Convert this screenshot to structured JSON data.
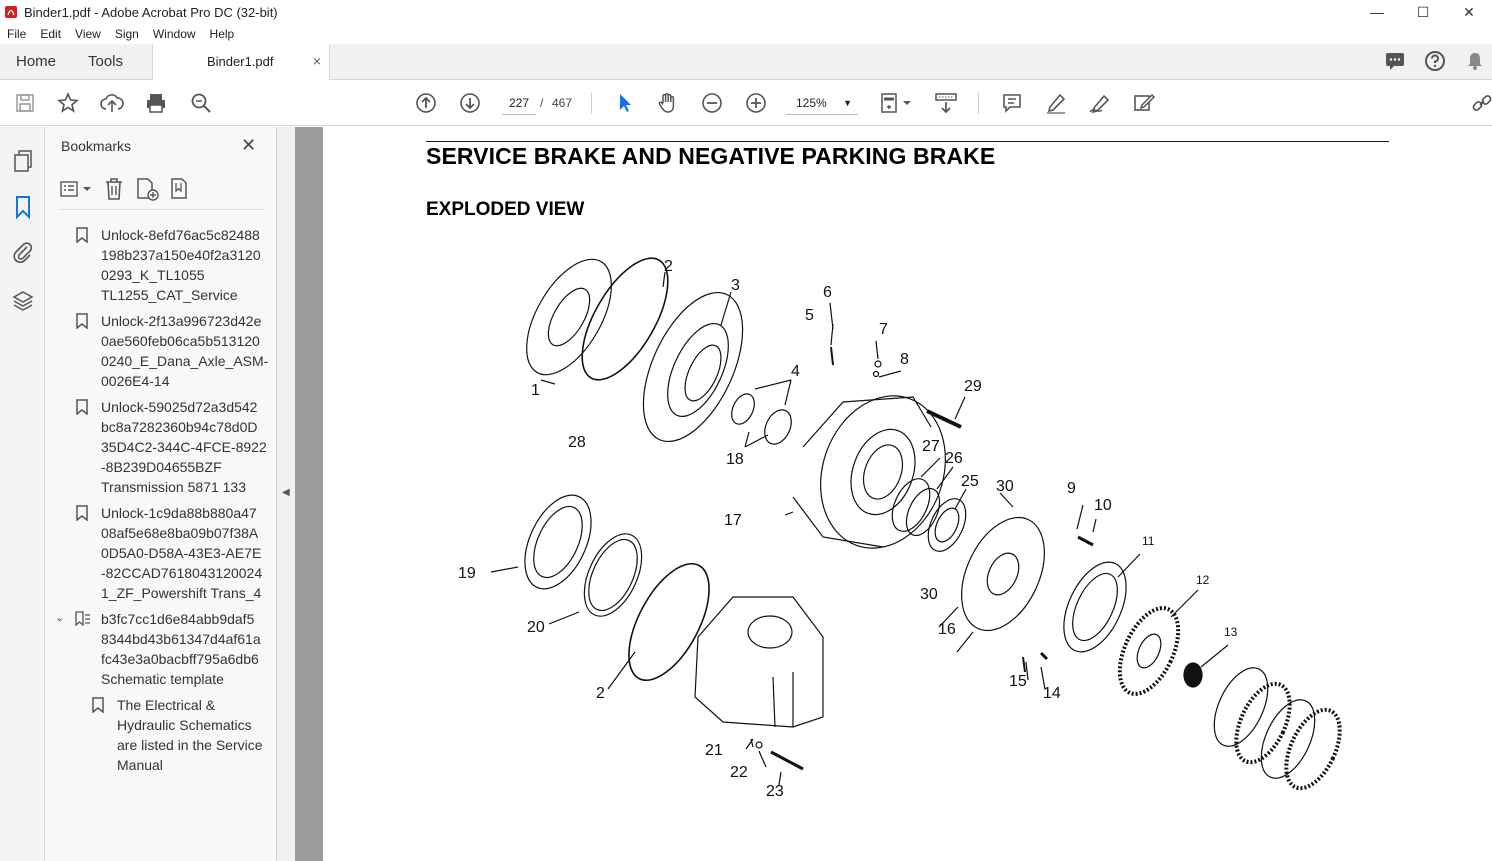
{
  "window": {
    "title": "Binder1.pdf - Adobe Acrobat Pro DC (32-bit)",
    "controls": [
      "—",
      "☐",
      "✕"
    ]
  },
  "menu": [
    "File",
    "Edit",
    "View",
    "Sign",
    "Window",
    "Help"
  ],
  "tabs": {
    "home": "Home",
    "tools": "Tools",
    "document": "Binder1.pdf",
    "close": "×"
  },
  "toolbar": {
    "current_page": "227",
    "separator": "/",
    "total_pages": "467",
    "zoom": "125%",
    "zoom_caret": "▼"
  },
  "bookmarks": {
    "title": "Bookmarks",
    "close": "✕",
    "items": [
      {
        "label": "Unlock-8efd76ac5c82488\n198b237a150e40f2a3120\n0293_K_TL1055\nTL1255_CAT_Service"
      },
      {
        "label": "Unlock-2f13a996723d42e\n0ae560feb06ca5b513120\n0240_E_Dana_Axle_ASM-\n0026E4-14"
      },
      {
        "label": "Unlock-59025d72a3d542\nbc8a7282360b94c78d0D\n35D4C2-344C-4FCE-8922\n-8B239D04655BZF\nTransmission 5871 133"
      },
      {
        "label": "Unlock-1c9da88b880a47\n08af5e68e8ba09b07f38A\n0D5A0-D58A-43E3-AE7E\n-82CCAD7618043120024\n1_ZF_Powershift Trans_4"
      },
      {
        "label": "b3fc7cc1d6e84abb9daf5\n8344bd43b61347d4af61a\nfc43e3a0bacbff795a6db6\nSchematic template",
        "expanded": true,
        "expander": "⌄"
      },
      {
        "label": "The Electrical &\nHydraulic Schematics\nare listed in the Service\nManual",
        "child": true
      }
    ]
  },
  "document": {
    "title": "SERVICE BRAKE AND NEGATIVE PARKING BRAKE",
    "subtitle": "EXPLODED VIEW",
    "callouts": [
      "1",
      "2",
      "3",
      "4",
      "5",
      "6",
      "7",
      "8",
      "29",
      "28",
      "18",
      "27",
      "26",
      "25",
      "17",
      "30",
      "9",
      "10",
      "11",
      "12",
      "13",
      "19",
      "20",
      "2",
      "30",
      "16",
      "15",
      "14",
      "21",
      "22",
      "23"
    ]
  },
  "colors": {
    "acrobat_red": "#d71e1e",
    "selection_blue": "#1473e6",
    "panel_bg": "#f8f8f8",
    "canvas_gray": "#9b9b9b"
  }
}
